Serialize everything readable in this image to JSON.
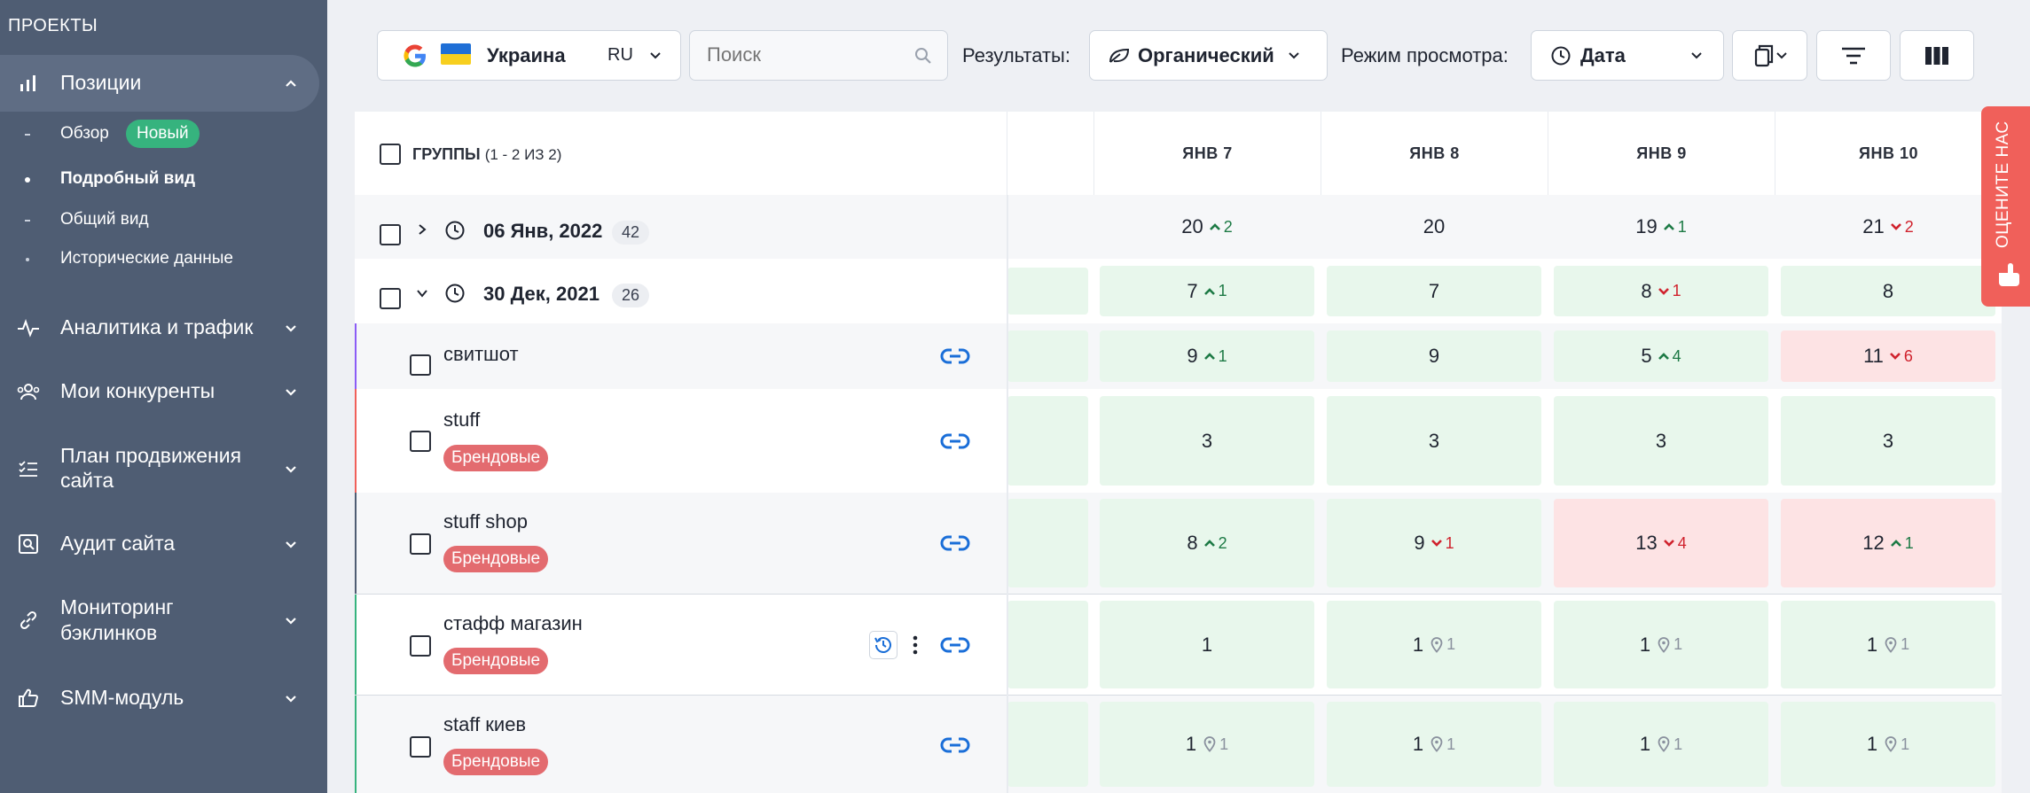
{
  "sidebar": {
    "title": "ПРОЕКТЫ",
    "positions": "Позиции",
    "sub": [
      {
        "label": "Обзор",
        "badge": "Новый"
      },
      {
        "label": "Подробный вид"
      },
      {
        "label": "Общий вид"
      },
      {
        "label": "Исторические данные"
      }
    ],
    "analytics": "Аналитика и трафик",
    "competitors": "Мои конкуренты",
    "plan_l1": "План продвижения",
    "plan_l2": "сайта",
    "audit": "Аудит сайта",
    "backlinks_l1": "Мониторинг",
    "backlinks_l2": "бэклинков",
    "smm": "SMM-модуль"
  },
  "toolbar": {
    "country": "Украина",
    "lang": "RU",
    "search_placeholder": "Поиск",
    "results_label": "Результаты:",
    "results_value": "Органический",
    "mode_label": "Режим просмотра:",
    "mode_value": "Дата"
  },
  "table": {
    "groups_header": "ГРУППЫ",
    "groups_count": "(1 - 2 ИЗ 2)",
    "dates": [
      "ЯНВ 7",
      "ЯНВ 8",
      "ЯНВ 9",
      "ЯНВ 10"
    ],
    "group1": {
      "date": "06 Янв, 2022",
      "count": "42",
      "cells": [
        {
          "v": "20",
          "d": "2",
          "t": "up"
        },
        {
          "v": "20"
        },
        {
          "v": "19",
          "d": "1",
          "t": "up"
        },
        {
          "v": "21",
          "d": "2",
          "t": "dn"
        }
      ]
    },
    "group2": {
      "date": "30 Дек, 2021",
      "count": "26",
      "cells": [
        {
          "v": "7",
          "d": "1",
          "t": "up"
        },
        {
          "v": "7"
        },
        {
          "v": "8",
          "d": "1",
          "t": "dn"
        },
        {
          "v": "8"
        }
      ]
    },
    "brand_tag": "Брендовые",
    "keywords": [
      {
        "name": "свитшот",
        "cells": [
          {
            "v": "9",
            "d": "1",
            "t": "up"
          },
          {
            "v": "9"
          },
          {
            "v": "5",
            "d": "4",
            "t": "up"
          },
          {
            "v": "11",
            "d": "6",
            "t": "dn"
          }
        ]
      },
      {
        "name": "stuff",
        "cells": [
          {
            "v": "3"
          },
          {
            "v": "3"
          },
          {
            "v": "3"
          },
          {
            "v": "3"
          }
        ]
      },
      {
        "name": "stuff shop",
        "cells": [
          {
            "v": "8",
            "d": "2",
            "t": "up"
          },
          {
            "v": "9",
            "d": "1",
            "t": "dn"
          },
          {
            "v": "13",
            "d": "4",
            "t": "dn"
          },
          {
            "v": "12",
            "d": "1",
            "t": "up"
          }
        ]
      },
      {
        "name": "стафф магазин",
        "cells": [
          {
            "v": "1"
          },
          {
            "v": "1",
            "p": "1"
          },
          {
            "v": "1",
            "p": "1"
          },
          {
            "v": "1",
            "p": "1"
          }
        ]
      },
      {
        "name": "staff киев",
        "cells": [
          {
            "v": "1",
            "p": "1"
          },
          {
            "v": "1",
            "p": "1"
          },
          {
            "v": "1",
            "p": "1"
          },
          {
            "v": "1",
            "p": "1"
          }
        ]
      }
    ]
  },
  "rate_us": "ОЦЕНИТЕ НАС",
  "colors": {
    "sidebar": "#4f5d73",
    "green": "#e8f7ec",
    "red": "#fde3e4",
    "link": "#1a6ed8",
    "brand": "#e36b6f"
  }
}
